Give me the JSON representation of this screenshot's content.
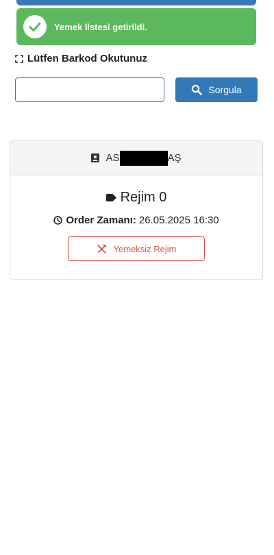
{
  "toast": {
    "message": "Yemek listesi getirildi."
  },
  "scan": {
    "title": "Lütfen Barkod Okutunuz",
    "input_value": "",
    "input_placeholder": ""
  },
  "query_button": {
    "label": "Sorgula"
  },
  "card": {
    "name_prefix": "AS",
    "name_suffix": "AŞ",
    "regime": "Rejim 0",
    "order_label": "Order Zamanı:",
    "order_time": "26.05.2025 16:30",
    "no_food_label": "Yemeksiz Rejim"
  },
  "colors": {
    "primary": "#3378b7",
    "success": "#5cb85c",
    "danger": "#d9534f"
  }
}
